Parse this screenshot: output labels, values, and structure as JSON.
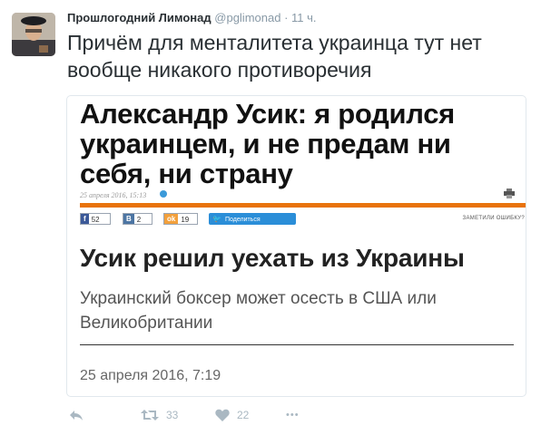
{
  "tweet": {
    "author_name": "Прошлогодний Лимонад",
    "author_handle": "@pglimonad",
    "separator": "·",
    "time": "11 ч.",
    "text": "Причём для менталитета украинца тут нет вообще никакого противоречия"
  },
  "card": {
    "headline_top": "Александр Усик: я родился украинцем, и не предам ни себя, ни страну",
    "top_date": "25 апреля 2016, 15:13",
    "share": {
      "facebook_icon": "f",
      "facebook_count": "52",
      "vk_icon": "B",
      "vk_count": "2",
      "ok_icon": "ok",
      "ok_count": "19",
      "twitter_label": "Поделиться"
    },
    "report_label": "ЗАМЕТИЛИ ОШИБКУ?",
    "headline_main": "Усик решил уехать из Украины",
    "subtitle": "Украинский боксер может осесть в США или Великобритании",
    "date": "25 апреля 2016, 7:19"
  },
  "actions": {
    "retweets": "33",
    "likes": "22",
    "more": "•••"
  },
  "colors": {
    "orange_rule": "#e8730c",
    "twitter_blue": "#2b8ed8",
    "facebook": "#3b5998",
    "vk": "#4c75a3",
    "ok": "#f2a03c",
    "action_gray": "#aab8c2"
  }
}
